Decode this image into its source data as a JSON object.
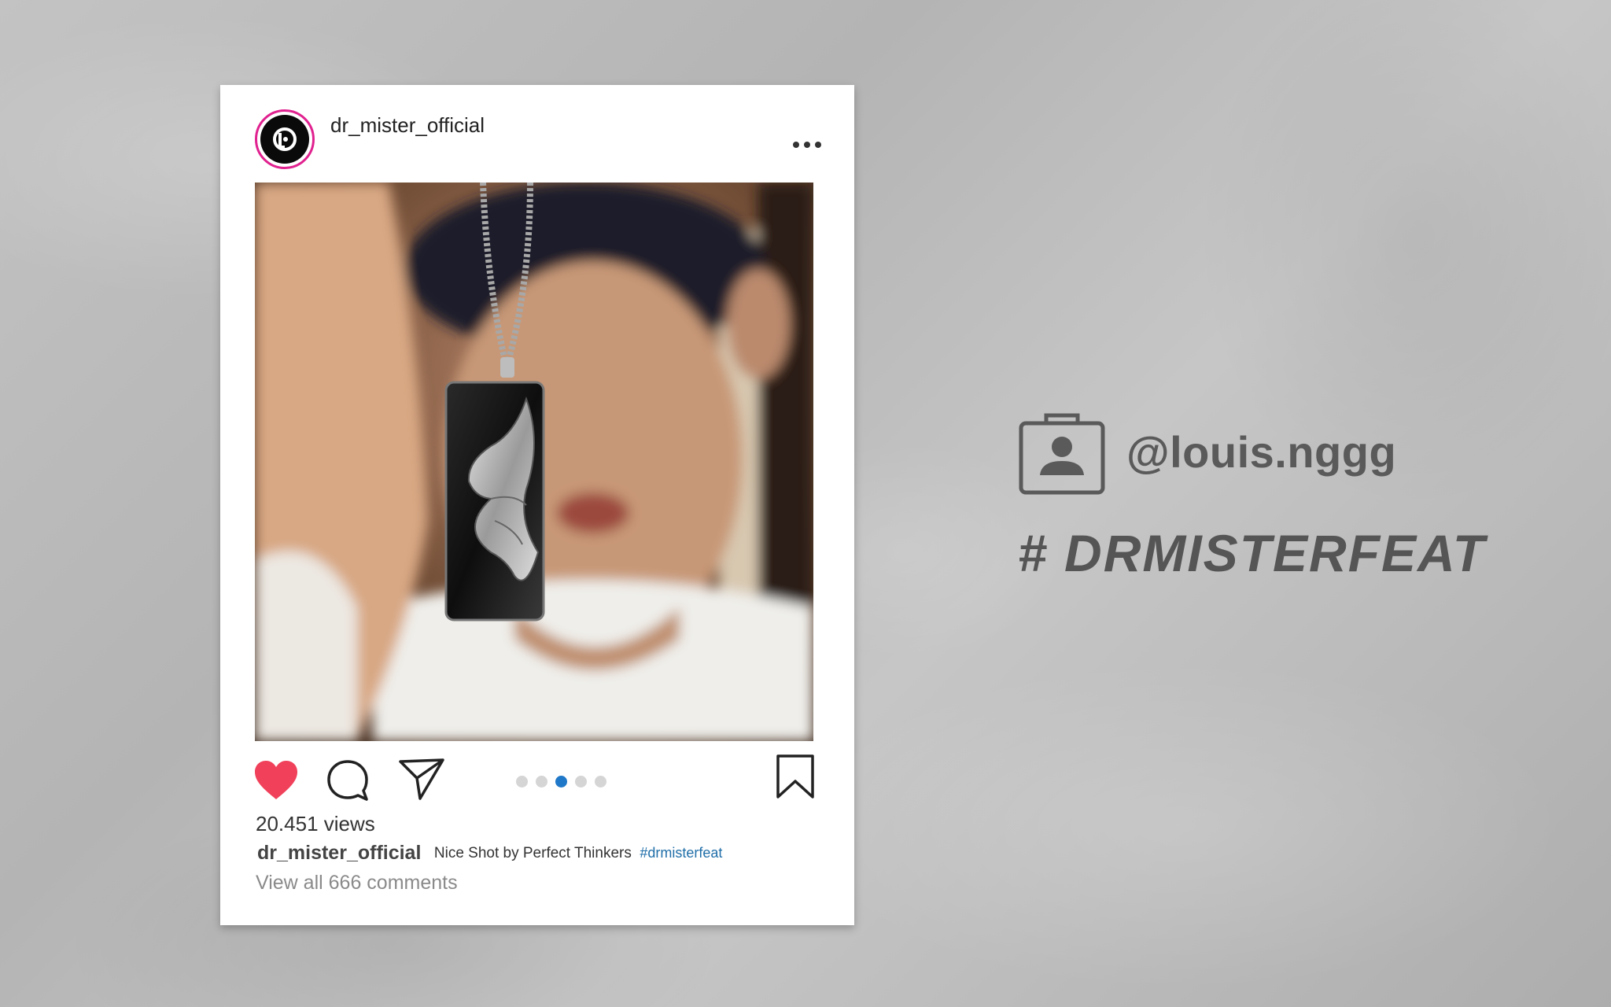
{
  "post": {
    "username": "dr_mister_official",
    "views": "20.451 views",
    "caption_user": "dr_mister_official",
    "caption_text": "Nice Shot by Perfect Thinkers",
    "caption_hashtag": "#drmisterfeat",
    "comments_link": "View all 666 comments",
    "carousel": {
      "count": 5,
      "active_index": 2
    },
    "liked": true
  },
  "overlay": {
    "handle": "@louis.nggg",
    "hashtag": "# DRMISTERFEAT"
  },
  "colors": {
    "like": "#f0405a",
    "active_dot": "#1f78c8",
    "avatar_ring": "#e0218f",
    "hashtag_link": "#1f6ea8"
  },
  "icons": [
    "dr-logo-icon",
    "more-options-icon",
    "heart-icon",
    "comment-icon",
    "share-icon",
    "bookmark-icon",
    "contact-card-icon"
  ]
}
